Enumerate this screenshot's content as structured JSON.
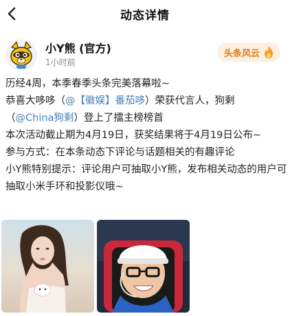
{
  "header": {
    "title": "动态详情"
  },
  "author": {
    "name": "小Y熊 (官方)",
    "time": "1小时前",
    "badge": "头条风云"
  },
  "post": {
    "line1": "历经4周，本季春季头条完美落幕啦~",
    "line2_prefix": "恭喜大哆哆（",
    "mention1": "@【徽娱】番茄哆",
    "line2_suffix": "）荣获代言人，狗剩",
    "line3_prefix": "（",
    "mention2": "@China狗剩",
    "line3_suffix": "）登上了擂主榜榜首",
    "line4": "本次活动截止期为4月19日，获奖结果将于4月19日公布~",
    "line5": "参与方式：在本条动态下评论与话题相关的有趣评论",
    "line6": "小Y熊特别提示：评论用户可抽取小Y熊，发布相关动态的用户可抽取小米手环和投影仪哦~"
  },
  "colors": {
    "link": "#4a7ebd",
    "badge_text": "#e07a1c",
    "badge_bg": "#fdf0e1"
  },
  "icons": [
    "back-arrow-icon",
    "flame-icon"
  ]
}
